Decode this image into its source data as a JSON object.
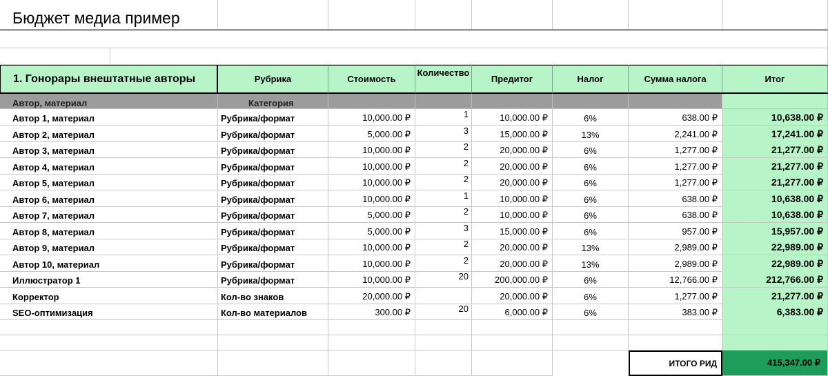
{
  "title": "Бюджет медиа пример",
  "header": {
    "section": "1. Гонорары внештатные авторы",
    "rubric": "Рубрика",
    "cost": "Стоимость",
    "qty": "Количество",
    "pretotal": "Предитог",
    "tax": "Налог",
    "tax_sum": "Сумма налога",
    "total": "Итог"
  },
  "subheader": {
    "author": "Автор, материал",
    "category": "Категория"
  },
  "rows": [
    {
      "name": "Автор 1, материал",
      "rubric": "Рубрика/формат",
      "cost": "10,000.00 ₽",
      "qty": "1",
      "pretotal": "10,000.00 ₽",
      "tax": "6%",
      "tax_sum": "638.00 ₽",
      "total": "10,638.00 ₽"
    },
    {
      "name": "Автор 2, материал",
      "rubric": "Рубрика/формат",
      "cost": "5,000.00 ₽",
      "qty": "3",
      "pretotal": "15,000.00 ₽",
      "tax": "13%",
      "tax_sum": "2,241.00 ₽",
      "total": "17,241.00 ₽"
    },
    {
      "name": "Автор 3, материал",
      "rubric": "Рубрика/формат",
      "cost": "10,000.00 ₽",
      "qty": "2",
      "pretotal": "20,000.00 ₽",
      "tax": "6%",
      "tax_sum": "1,277.00 ₽",
      "total": "21,277.00 ₽"
    },
    {
      "name": "Автор 4, материал",
      "rubric": "Рубрика/формат",
      "cost": "10,000.00 ₽",
      "qty": "2",
      "pretotal": "20,000.00 ₽",
      "tax": "6%",
      "tax_sum": "1,277.00 ₽",
      "total": "21,277.00 ₽"
    },
    {
      "name": "Автор 5, материал",
      "rubric": "Рубрика/формат",
      "cost": "10,000.00 ₽",
      "qty": "2",
      "pretotal": "20,000.00 ₽",
      "tax": "6%",
      "tax_sum": "1,277.00 ₽",
      "total": "21,277.00 ₽"
    },
    {
      "name": "Автор 6, материал",
      "rubric": "Рубрика/формат",
      "cost": "10,000.00 ₽",
      "qty": "1",
      "pretotal": "10,000.00 ₽",
      "tax": "6%",
      "tax_sum": "638.00 ₽",
      "total": "10,638.00 ₽"
    },
    {
      "name": "Автор 7, материал",
      "rubric": "Рубрика/формат",
      "cost": "5,000.00 ₽",
      "qty": "2",
      "pretotal": "10,000.00 ₽",
      "tax": "6%",
      "tax_sum": "638.00 ₽",
      "total": "10,638.00 ₽"
    },
    {
      "name": "Автор 8, материал",
      "rubric": "Рубрика/формат",
      "cost": "5,000.00 ₽",
      "qty": "3",
      "pretotal": "15,000.00 ₽",
      "tax": "6%",
      "tax_sum": "957.00 ₽",
      "total": "15,957.00 ₽"
    },
    {
      "name": "Автор 9, материал",
      "rubric": "Рубрика/формат",
      "cost": "10,000.00 ₽",
      "qty": "2",
      "pretotal": "20,000.00 ₽",
      "tax": "13%",
      "tax_sum": "2,989.00 ₽",
      "total": "22,989.00 ₽"
    },
    {
      "name": "Автор 10, материал",
      "rubric": "Рубрика/формат",
      "cost": "10,000.00 ₽",
      "qty": "2",
      "pretotal": "20,000.00 ₽",
      "tax": "13%",
      "tax_sum": "2,989.00 ₽",
      "total": "22,989.00 ₽"
    },
    {
      "name": "Иллюстратор 1",
      "rubric": "Рубрика/формат",
      "cost": "10,000.00 ₽",
      "qty": "20",
      "pretotal": "200,000.00 ₽",
      "tax": "6%",
      "tax_sum": "12,766.00 ₽",
      "total": "212,766.00 ₽"
    },
    {
      "name": "Корректор",
      "rubric": "Кол-во знаков",
      "cost": "20,000.00 ₽",
      "qty": "",
      "pretotal": "20,000.00 ₽",
      "tax": "6%",
      "tax_sum": "1,277.00 ₽",
      "total": "21,277.00 ₽"
    },
    {
      "name": "SEO-оптимизация",
      "rubric": "Кол-во материалов",
      "cost": "300.00 ₽",
      "qty": "20",
      "pretotal": "6,000.00 ₽",
      "tax": "6%",
      "tax_sum": "383.00 ₽",
      "total": "6,383.00 ₽"
    }
  ],
  "grand_total": {
    "label": "ИТОГО РИД",
    "value": "415,347.00 ₽"
  },
  "colors": {
    "header_green": "#b7f5c8",
    "total_dark_green": "#1e9c5a",
    "subheader_gray": "#9c9c9c"
  }
}
